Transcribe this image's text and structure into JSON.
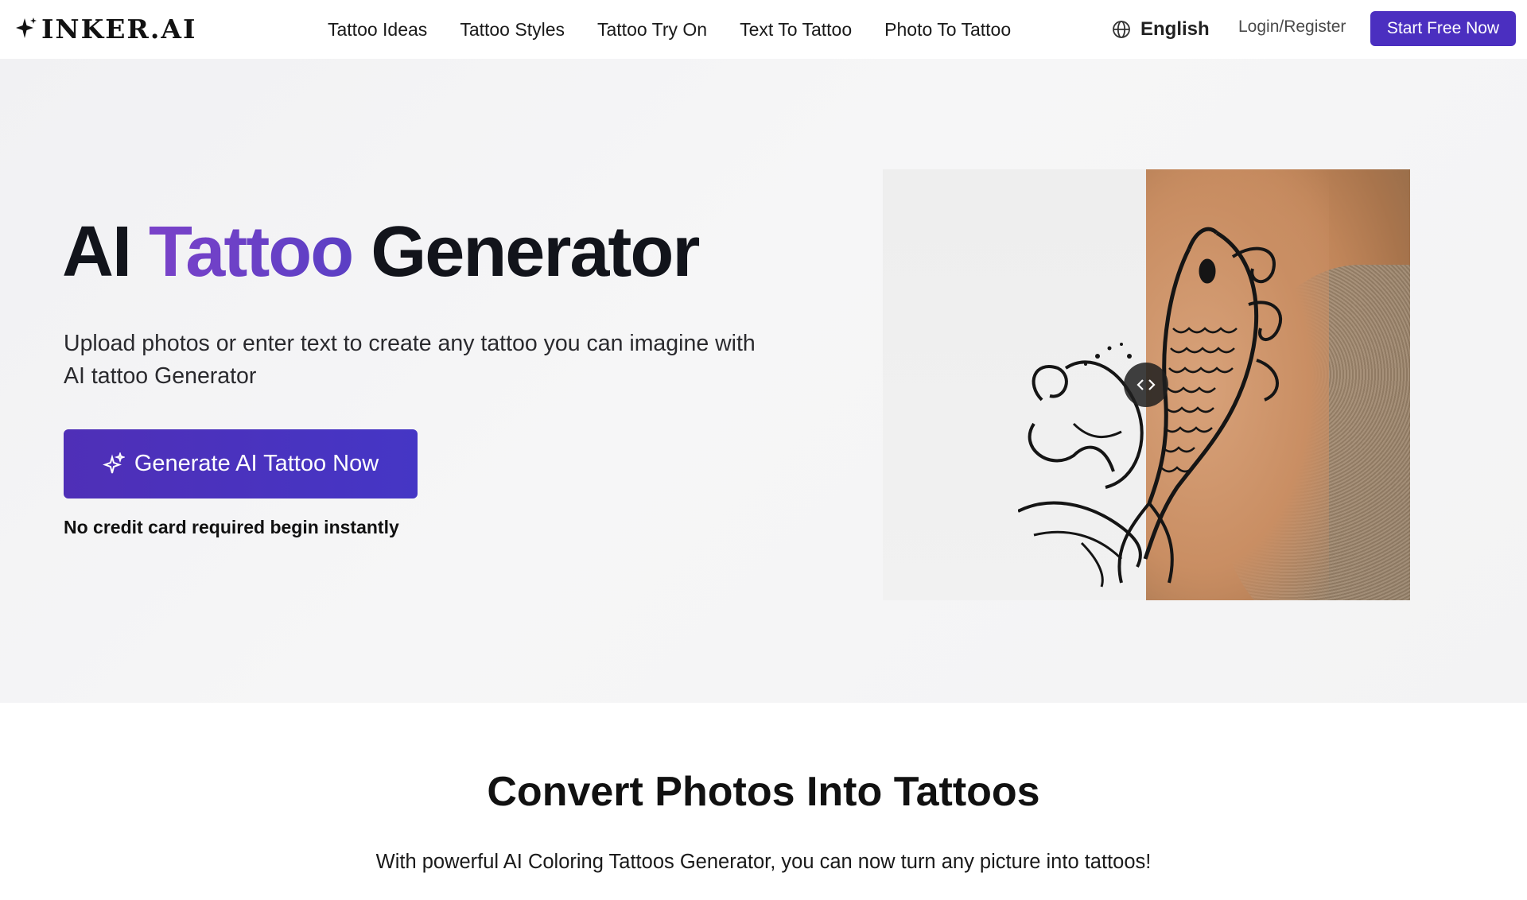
{
  "brand": {
    "name": "INKER.AI"
  },
  "nav": {
    "items": [
      {
        "label": "Tattoo Ideas"
      },
      {
        "label": "Tattoo Styles"
      },
      {
        "label": "Tattoo Try On"
      },
      {
        "label": "Text To Tattoo"
      },
      {
        "label": "Photo To Tattoo"
      }
    ],
    "language": "English",
    "login": "Login/Register",
    "cta": "Start Free Now"
  },
  "hero": {
    "title_part1": "AI ",
    "title_accent": "Tattoo",
    "title_part2": " Generator",
    "subtitle": "Upload photos or enter text to create any tattoo you can imagine with AI tattoo Generator",
    "cta": "Generate AI Tattoo Now",
    "note": "No credit card required begin instantly"
  },
  "compare": {
    "handle_icon": "code-arrows-icon"
  },
  "section2": {
    "title": "Convert Photos Into Tattoos",
    "subtitle": "With powerful AI Coloring Tattoos Generator, you can now turn any picture into tattoos!"
  },
  "colors": {
    "accent": "#4b2fc0",
    "accent_gradient_start": "#7a42c9",
    "text": "#111318"
  }
}
